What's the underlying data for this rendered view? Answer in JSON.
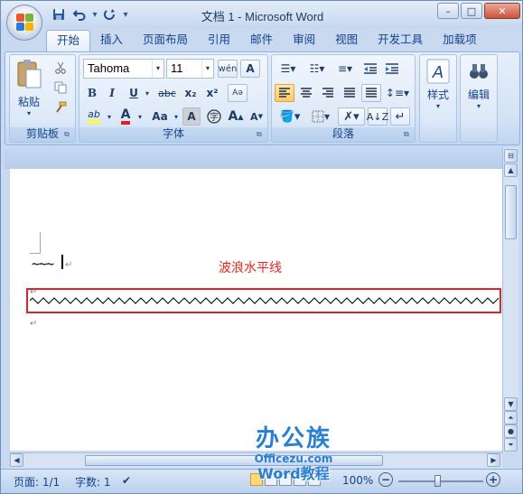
{
  "titlebar": {
    "title": "文档 1 - Microsoft Word"
  },
  "qat": {
    "save_icon": "save-icon",
    "undo_icon": "undo-icon",
    "redo_icon": "redo-icon",
    "customize_icon": "dropdown-icon"
  },
  "window_buttons": {
    "minimize": "–",
    "maximize": "□",
    "close": "✕"
  },
  "tabs": [
    {
      "label": "开始",
      "active": true
    },
    {
      "label": "插入"
    },
    {
      "label": "页面布局"
    },
    {
      "label": "引用"
    },
    {
      "label": "邮件"
    },
    {
      "label": "审阅"
    },
    {
      "label": "视图"
    },
    {
      "label": "开发工具"
    },
    {
      "label": "加载项"
    }
  ],
  "ribbon": {
    "clipboard": {
      "label": "剪贴板",
      "paste": "粘贴"
    },
    "font": {
      "label": "字体",
      "font_name": "Tahoma",
      "font_size": "11",
      "bold": "B",
      "italic": "I",
      "underline": "U",
      "strike": "abc",
      "subscript": "x₂",
      "superscript": "x²",
      "grow": "A",
      "shrink": "A",
      "case": "Aa",
      "highlight": "ab"
    },
    "paragraph": {
      "label": "段落"
    },
    "styles": {
      "label": "样式"
    },
    "editing": {
      "label": "编辑"
    }
  },
  "document": {
    "tilde_text": "~~~",
    "annotation": "波浪水平线",
    "return_mark": "↵"
  },
  "status": {
    "page": "页面: 1/1",
    "words": "字数: 1",
    "zoom": "100%"
  },
  "watermark": {
    "brand": "办公族",
    "url": "Officezu.com",
    "subtitle": "Word教程"
  },
  "colors": {
    "accent": "#15428b",
    "red_box": "#d8262a",
    "annotation": "#e0271f",
    "watermark": "#2a7fd1"
  }
}
